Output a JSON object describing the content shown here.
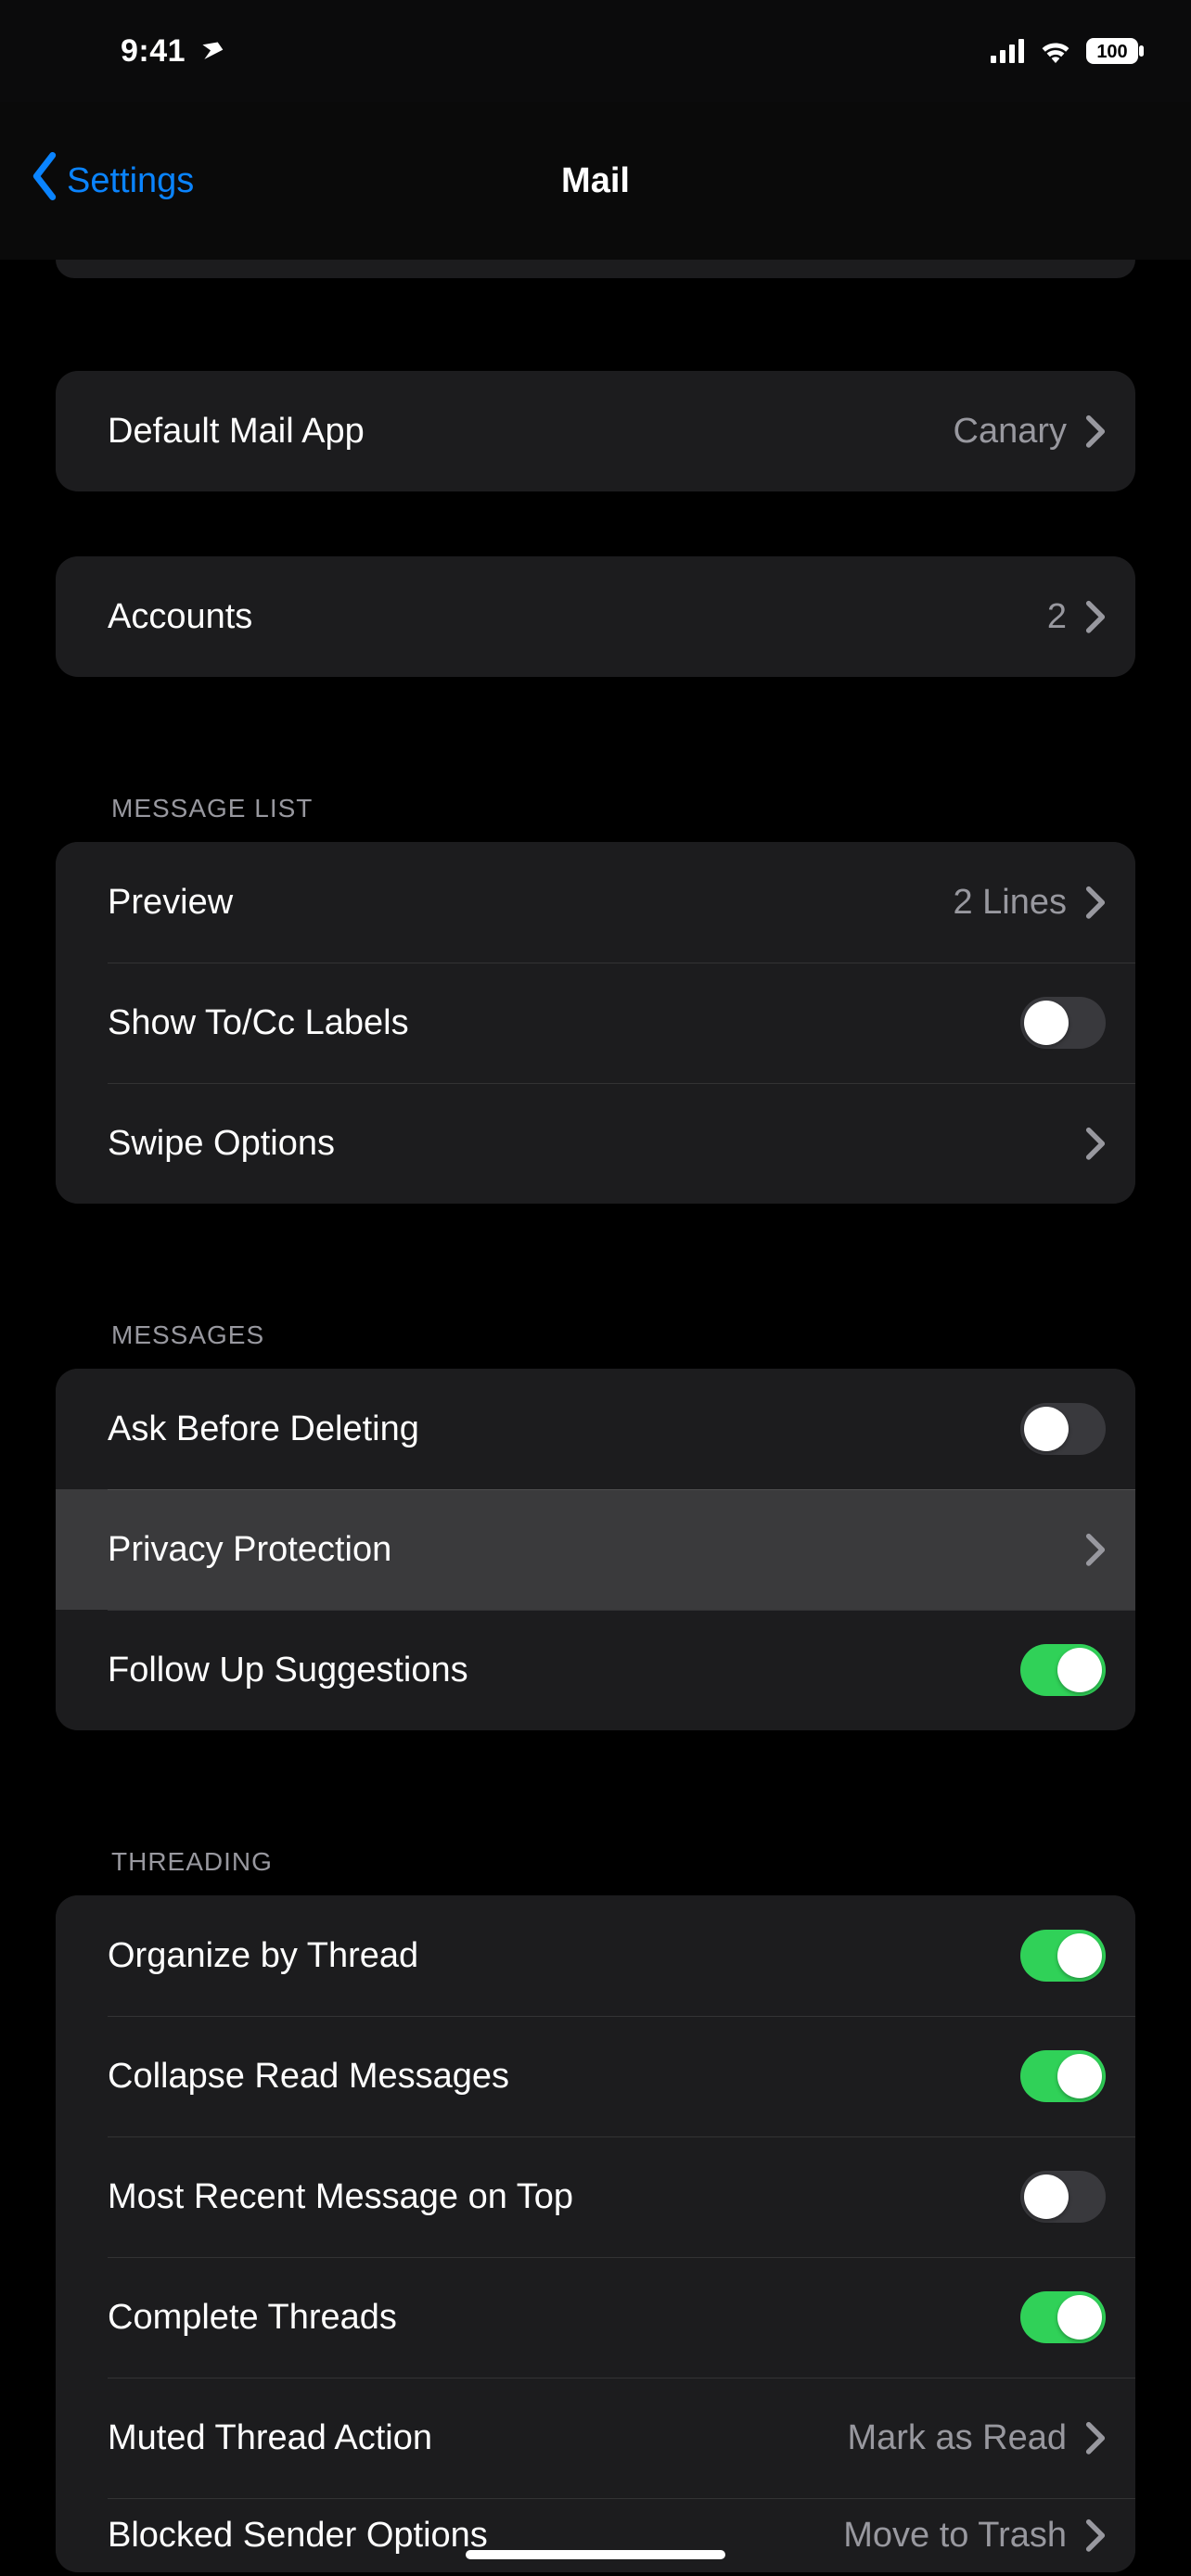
{
  "status": {
    "time": "9:41",
    "battery": "100"
  },
  "nav": {
    "back": "Settings",
    "title": "Mail"
  },
  "groups": {
    "default_app": {
      "label": "Default Mail App",
      "value": "Canary"
    },
    "accounts": {
      "label": "Accounts",
      "value": "2"
    }
  },
  "sections": {
    "message_list": {
      "header": "MESSAGE LIST",
      "preview": {
        "label": "Preview",
        "value": "2 Lines"
      },
      "show_tocc": {
        "label": "Show To/Cc Labels",
        "on": false
      },
      "swipe": {
        "label": "Swipe Options"
      }
    },
    "messages": {
      "header": "MESSAGES",
      "ask_delete": {
        "label": "Ask Before Deleting",
        "on": false
      },
      "privacy": {
        "label": "Privacy Protection"
      },
      "followup": {
        "label": "Follow Up Suggestions",
        "on": true
      }
    },
    "threading": {
      "header": "THREADING",
      "organize": {
        "label": "Organize by Thread",
        "on": true
      },
      "collapse": {
        "label": "Collapse Read Messages",
        "on": true
      },
      "recent_top": {
        "label": "Most Recent Message on Top",
        "on": false
      },
      "complete": {
        "label": "Complete Threads",
        "on": true
      },
      "muted": {
        "label": "Muted Thread Action",
        "value": "Mark as Read"
      },
      "blocked": {
        "label": "Blocked Sender Options",
        "value": "Move to Trash"
      }
    }
  }
}
